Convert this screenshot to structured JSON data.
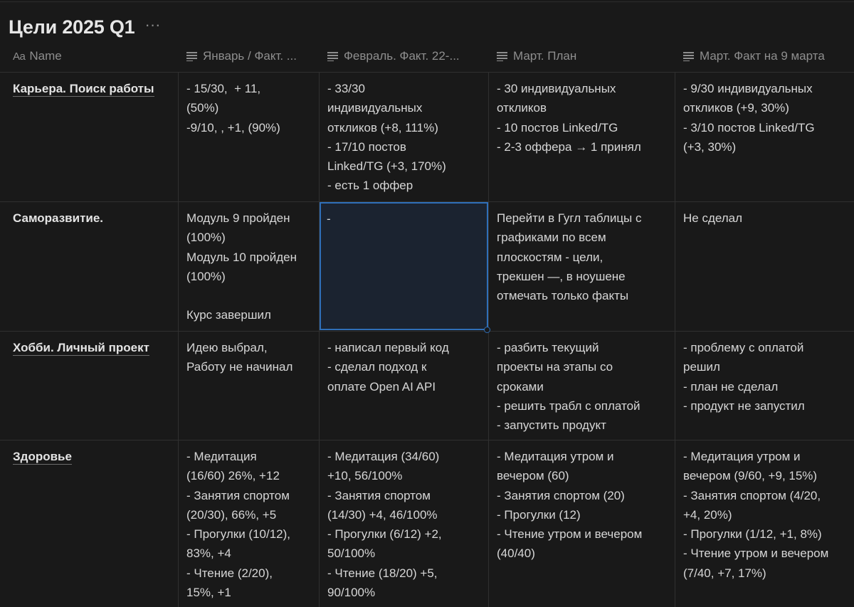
{
  "page": {
    "title": "Цели 2025 Q1",
    "more_label": "···"
  },
  "columns": [
    {
      "icon": "title-property-icon",
      "label": "Name",
      "prefix": "Aa"
    },
    {
      "icon": "text-property-icon",
      "label": "Январь / Факт. ..."
    },
    {
      "icon": "text-property-icon",
      "label": "Февраль. Факт. 22-..."
    },
    {
      "icon": "text-property-icon",
      "label": "Март. План"
    },
    {
      "icon": "text-property-icon",
      "label": "Март. Факт на 9 марта"
    }
  ],
  "rows": [
    {
      "name": "Карьера. Поиск работы",
      "jan": "- 15/30,  + 11,\n(50%)\n-9/10, , +1, (90%)",
      "feb": "- 33/30\nиндивидуальных\nоткликов (+8, 111%)\n- 17/10 постов\nLinked/TG (+3, 170%)\n- есть 1 оффер",
      "mar_plan": "- 30 индивидуальных\nоткликов\n- 10 постов Linked/TG\n- 2-3 оффера → 1 принял",
      "mar_fact": "- 9/30 индивидуальных\nоткликов (+9, 30%)\n- 3/10 постов Linked/TG\n(+3, 30%)"
    },
    {
      "name": "Саморазвитие.",
      "jan": "Модуль 9 пройден\n(100%)\nМодуль 10 пройден\n(100%)\n\nКурс завершил",
      "feb": "-",
      "mar_plan": "Перейти в Гугл таблицы с\nграфиками по всем\nплоскостям - цели,\nтрекшен —, в ноушене\nотмечать только факты",
      "mar_fact": "Не сделал"
    },
    {
      "name": "Хобби. Личный проект",
      "jan": "Идею выбрал,\nРаботу не начинал",
      "feb": "- написал первый код\n- сделал подход к\nоплате Open AI API",
      "mar_plan": "- разбить текущий\nпроекты на этапы со\nсроками\n- решить трабл с оплатой\n- запустить продукт",
      "mar_fact": "- проблему с оплатой\nрешил\n- план не сделал\n- продукт не запустил"
    },
    {
      "name": "Здоровье",
      "jan": "- Медитация\n(16/60) 26%, +12\n- Занятия спортом\n(20/30), 66%, +5\n- Прогулки (10/12),\n83%, +4\n- Чтение (2/20),\n15%, +1",
      "feb": "- Медитация (34/60)\n+10, 56/100%\n- Занятия спортом\n(14/30) +4, 46/100%\n- Прогулки (6/12) +2,\n50/100%\n- Чтение (18/20) +5,\n90/100%",
      "mar_plan": "- Медитация утром и\nвечером (60)\n- Занятия спортом (20)\n- Прогулки (12)\n- Чтение утром и вечером\n(40/40)",
      "mar_fact": "- Медитация утром и\nвечером (9/60, +9, 15%)\n- Занятия спортом (4/20,\n+4, 20%)\n- Прогулки (1/12, +1, 8%)\n- Чтение утром и вечером\n(7/40, +7, 17%)"
    }
  ]
}
